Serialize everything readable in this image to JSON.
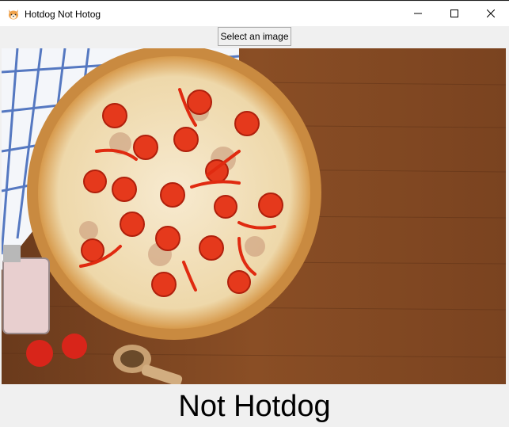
{
  "window": {
    "title": "Hotdog Not Hotog",
    "app_icon": "shiba-dog-icon",
    "controls": {
      "minimize_icon": "minimize-icon",
      "maximize_icon": "maximize-icon",
      "close_icon": "close-icon"
    }
  },
  "toolbar": {
    "select_label": "Select an image"
  },
  "image": {
    "subject": "pizza-photo"
  },
  "result": {
    "label": "Not Hotdog"
  },
  "colors": {
    "titlebar_bg": "#ffffff",
    "window_bg": "#f0f0f0",
    "wood": "#7a4320",
    "cheese": "#f1dfb7",
    "tomato": "#e5391c",
    "crust": "#d79a4c"
  }
}
